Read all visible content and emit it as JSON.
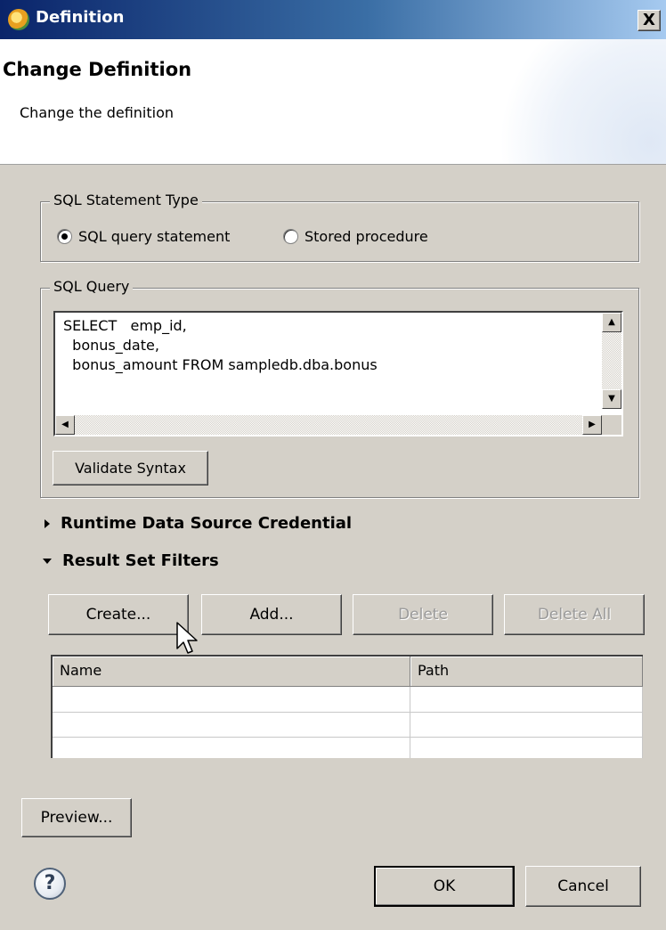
{
  "window": {
    "title": "Definition",
    "close_label": "X"
  },
  "header": {
    "title": "Change Definition",
    "description": "Change the definition"
  },
  "statement_type": {
    "group_label": "SQL Statement Type",
    "options": [
      {
        "label": "SQL query statement",
        "checked": true
      },
      {
        "label": "Stored procedure",
        "checked": false
      }
    ]
  },
  "sql_query": {
    "group_label": "SQL Query",
    "text": "SELECT   emp_id,\n  bonus_date,\n  bonus_amount FROM sampledb.dba.bonus",
    "validate_label": "Validate Syntax"
  },
  "sections": {
    "credential": {
      "label": "Runtime Data Source Credential",
      "expanded": false
    },
    "filters": {
      "label": "Result Set Filters",
      "expanded": true
    }
  },
  "filter_buttons": {
    "create": "Create...",
    "add": "Add...",
    "delete": "Delete",
    "delete_all": "Delete All"
  },
  "filter_table": {
    "columns": [
      "Name",
      "Path"
    ],
    "rows": [
      [
        "",
        ""
      ],
      [
        "",
        ""
      ],
      [
        "",
        ""
      ]
    ]
  },
  "footer": {
    "preview": "Preview...",
    "help_icon": "?",
    "ok": "OK",
    "cancel": "Cancel"
  }
}
